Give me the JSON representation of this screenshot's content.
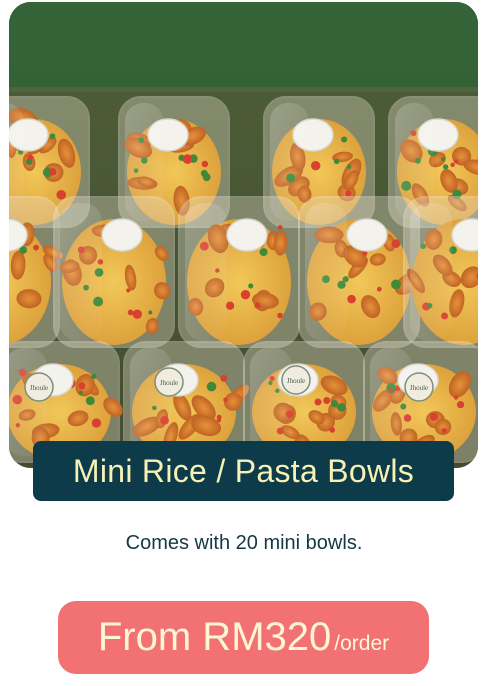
{
  "product": {
    "photo_alt": "Mini Rice / Pasta Bowls",
    "title": "Mini Rice / Pasta Bowls",
    "description": "Comes with 20 mini bowls.",
    "price_label": "From RM320",
    "price_unit": "/order",
    "lid_label": "Jhoule"
  },
  "colors": {
    "title_banner": "#0e3b4a",
    "title_text": "#f7f1b5",
    "description_text": "#143845",
    "price_button": "#f27273",
    "price_text": "#fff6d6"
  }
}
